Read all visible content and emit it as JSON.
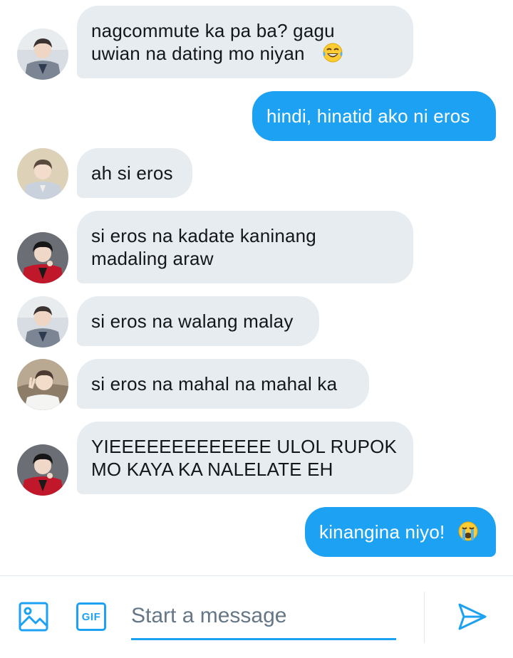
{
  "messages": [
    {
      "direction": "in",
      "avatar": "avatar-grey-suit",
      "text": "nagcommute ka pa ba? gagu\nuwian na dating mo niyan",
      "emoji": "laughing-tears-emoji"
    },
    {
      "direction": "out",
      "text": "hindi, hinatid ako ni eros"
    },
    {
      "direction": "in",
      "avatar": "avatar-light-jacket",
      "text": "ah si eros"
    },
    {
      "direction": "in",
      "avatar": "avatar-red-jacket",
      "text": "si eros na kadate kaninang\nmadaling araw"
    },
    {
      "direction": "in",
      "avatar": "avatar-grey-suit",
      "text": "si eros na walang malay"
    },
    {
      "direction": "in",
      "avatar": "avatar-peace-sign",
      "text": "si eros na mahal na mahal ka"
    },
    {
      "direction": "in",
      "avatar": "avatar-red-jacket",
      "text": "YIEEEEEEEEEEEEE ULOL RUPOK\nMO KAYA KA NALELATE EH"
    },
    {
      "direction": "out",
      "text": "kinangina niyo!",
      "emoji": "crying-emoji"
    }
  ],
  "composer": {
    "placeholder": "Start a message",
    "gif_label": "GIF",
    "icons": [
      "image-icon",
      "gif-icon",
      "send-icon"
    ]
  },
  "colors": {
    "accent": "#1da1f2",
    "incoming_bubble": "#e6ecf0",
    "incoming_text": "#14171a",
    "outgoing_text": "#ffffff"
  }
}
